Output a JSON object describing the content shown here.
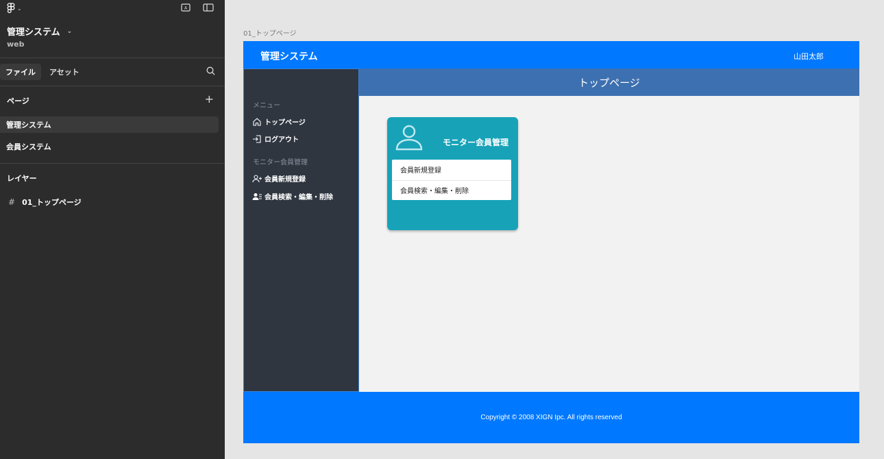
{
  "editor": {
    "project_title": "管理システム",
    "project_subtitle": "web",
    "tabs": [
      {
        "label": "ファイル"
      },
      {
        "label": "アセット"
      }
    ],
    "pages_section": "ページ",
    "pages": [
      {
        "label": "管理システム"
      },
      {
        "label": "会員システム"
      }
    ],
    "layers_section": "レイヤー",
    "layers": [
      {
        "label": "01_トップページ"
      }
    ]
  },
  "canvas": {
    "frame_label": "01_トップページ"
  },
  "app": {
    "title": "管理システム",
    "user": "山田太郎",
    "sidebar": {
      "menu_heading": "メニュー",
      "menu_items": [
        {
          "label": "トップページ",
          "icon": "home-icon"
        },
        {
          "label": "ログアウト",
          "icon": "logout-icon"
        }
      ],
      "member_heading": "モニター会員管理",
      "member_items": [
        {
          "label": "会員新規登録",
          "icon": "user-add-icon"
        },
        {
          "label": "会員検索・編集・削除",
          "icon": "user-list-icon"
        }
      ]
    },
    "page_heading": "トップページ",
    "card": {
      "title": "モニター会員管理",
      "links": [
        {
          "label": "会員新規登録"
        },
        {
          "label": "会員検索・編集・削除"
        }
      ]
    },
    "footer": "Copyright © 2008 XIGN Ipc. All rights reserved"
  },
  "colors": {
    "header_blue": "#0078ff",
    "heading_blue": "#3d70b0",
    "sidebar_dark": "#2f3640",
    "card_teal": "#17a2b8",
    "editor_dark": "#2c2c2c"
  }
}
